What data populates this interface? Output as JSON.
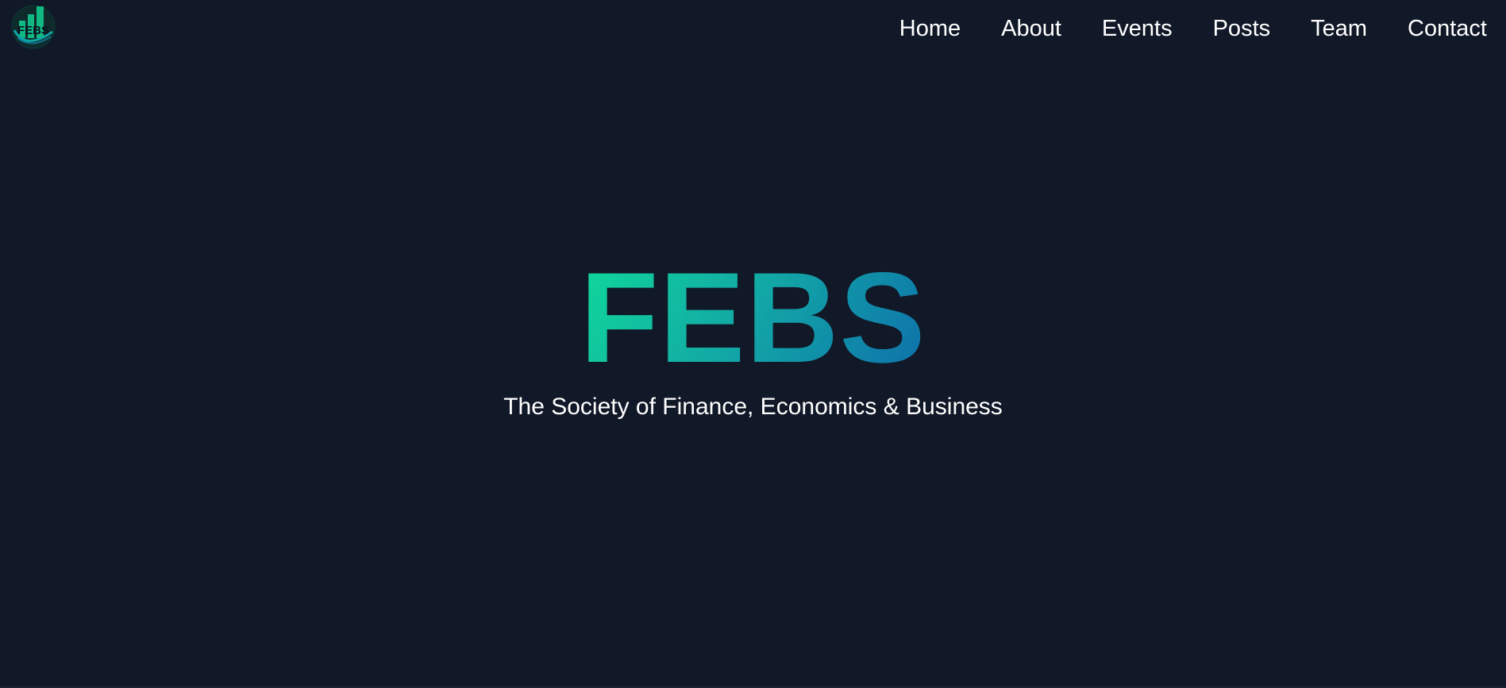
{
  "header": {
    "logo": {
      "text": "FEBS",
      "icon": "febs-logo-icon",
      "colors": {
        "bars": "#10b981",
        "arc": "#0ea5a5"
      }
    },
    "nav": [
      {
        "label": "Home"
      },
      {
        "label": "About"
      },
      {
        "label": "Events"
      },
      {
        "label": "Posts"
      },
      {
        "label": "Team"
      },
      {
        "label": "Contact"
      }
    ]
  },
  "hero": {
    "title": "FEBS",
    "subtitle": "The Society of Finance, Economics & Business",
    "title_gradient": [
      "#10d99a",
      "#12a6a6",
      "#0e6fab"
    ]
  },
  "theme": {
    "background": "#111827",
    "text": "#ffffff"
  }
}
